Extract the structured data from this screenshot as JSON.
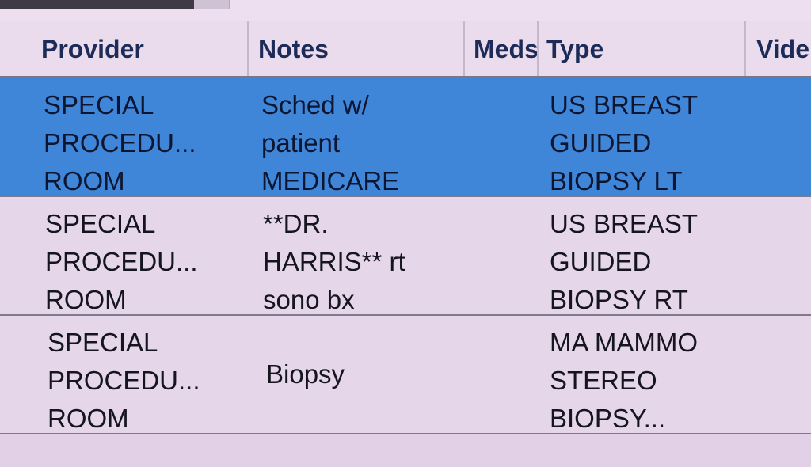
{
  "columns": {
    "provider": "Provider",
    "notes": "Notes",
    "meds": "Meds",
    "type": "Type",
    "video": "Vide"
  },
  "rows": [
    {
      "selected": true,
      "provider": "SPECIAL\nPROCEDU...\nROOM",
      "notes": "Sched w/\npatient\nMEDICARE",
      "meds": "",
      "type": "US BREAST\nGUIDED\nBIOPSY LT"
    },
    {
      "selected": false,
      "provider": "SPECIAL\nPROCEDU...\nROOM",
      "notes": "**DR.\nHARRIS** rt\nsono bx",
      "meds": "",
      "type": "US BREAST\nGUIDED\nBIOPSY RT"
    },
    {
      "selected": false,
      "provider": "SPECIAL\nPROCEDU...\nROOM",
      "notes": "Biopsy",
      "meds": "",
      "type": "MA MAMMO\nSTEREO\nBIOPSY..."
    }
  ],
  "colors": {
    "selection": "#3f85d8",
    "header_text": "#1c2b57",
    "background": "#e6d6e9"
  }
}
